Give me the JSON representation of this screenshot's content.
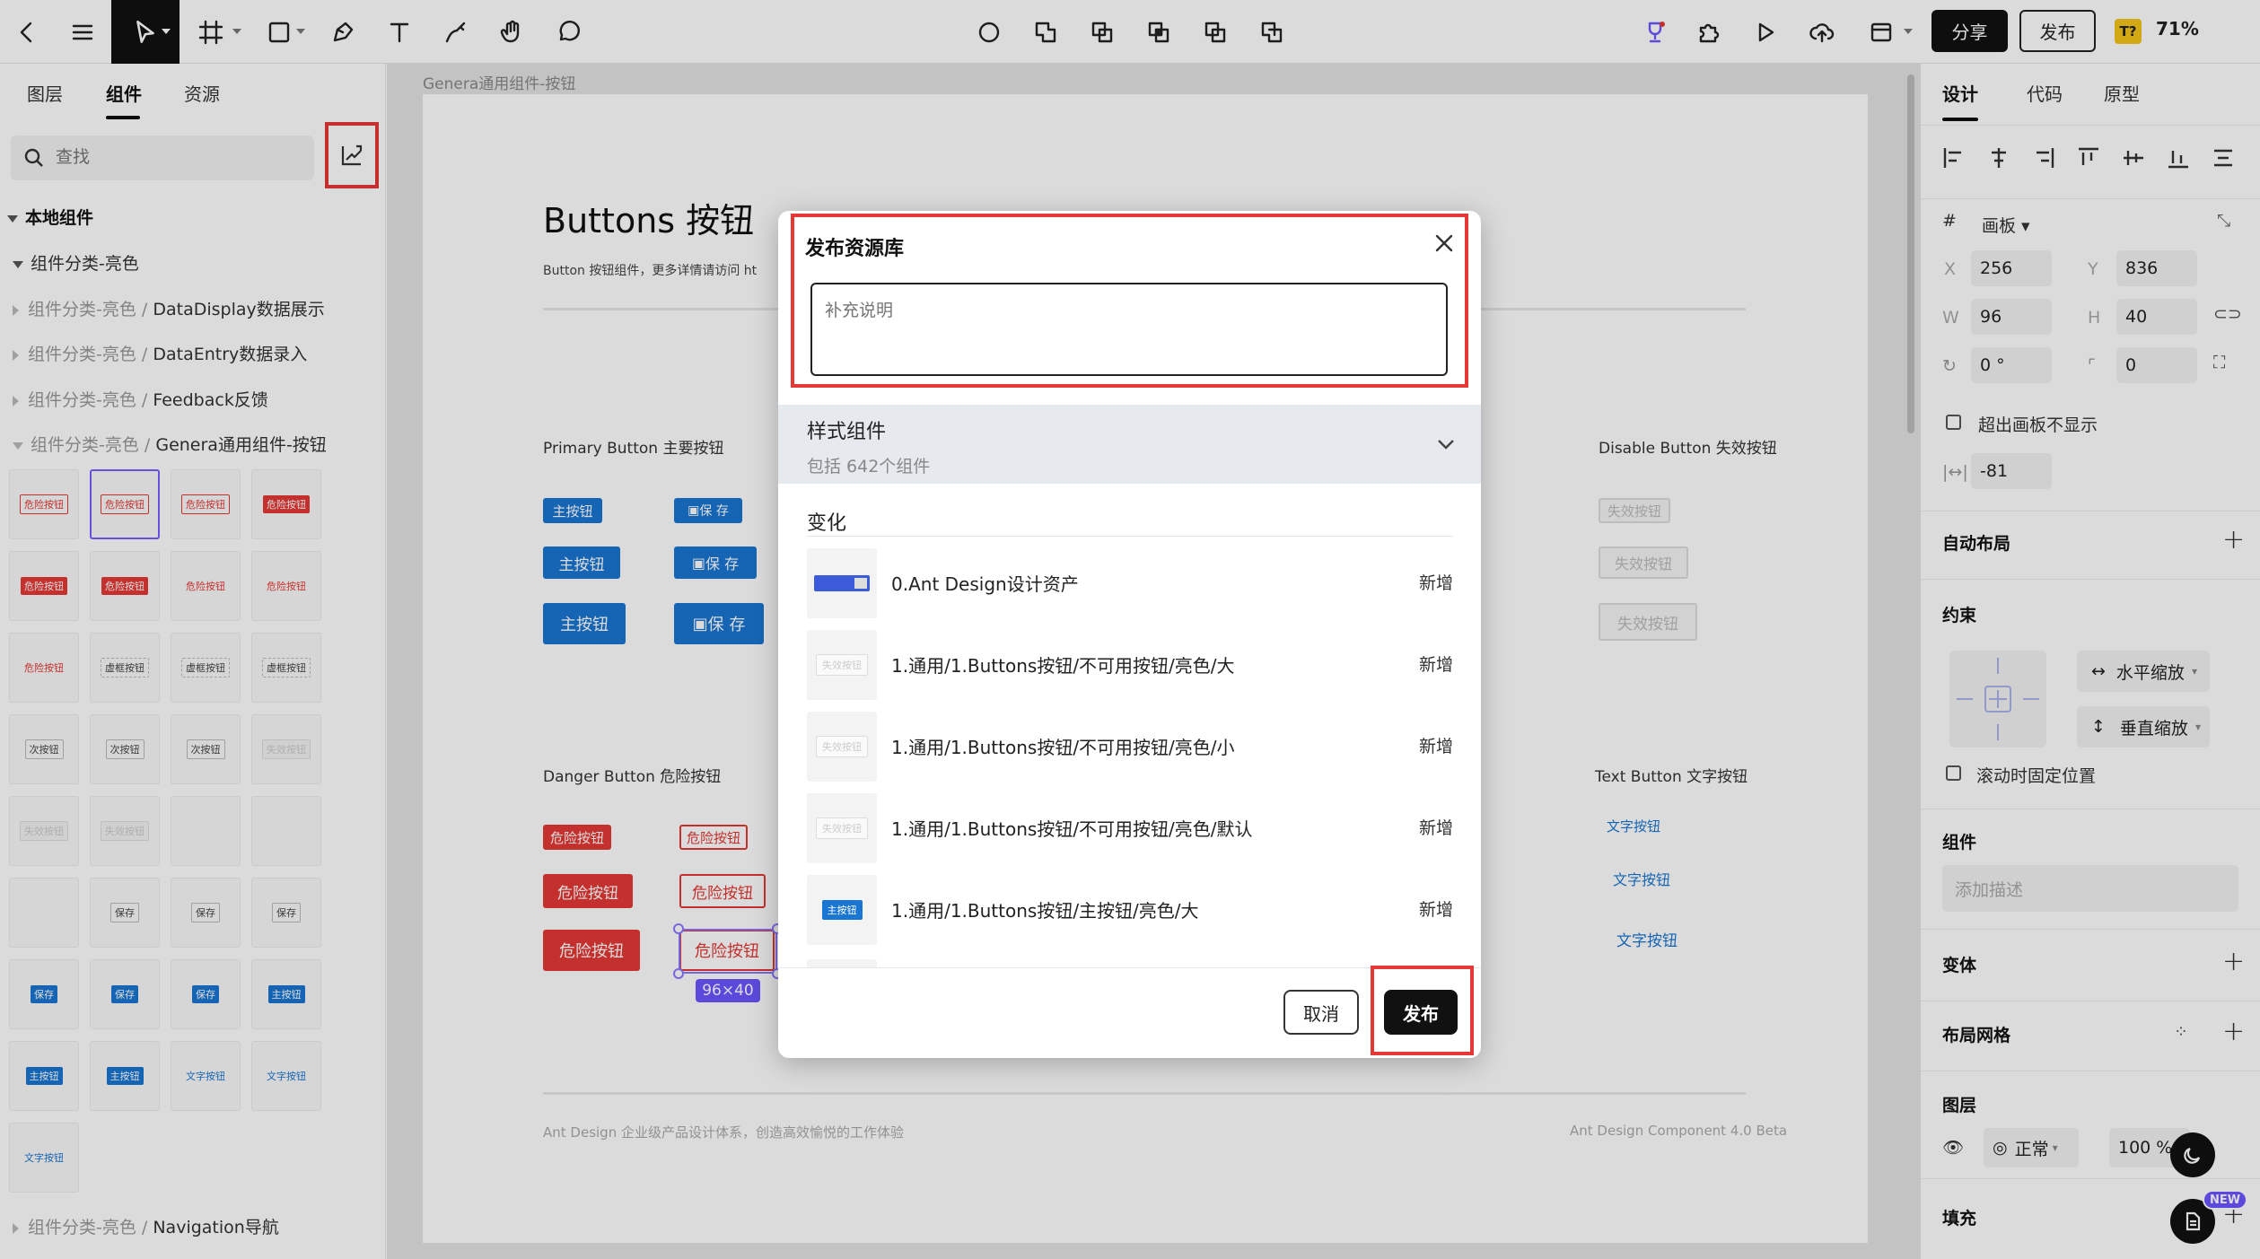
{
  "toolbar": {
    "share_label": "分享",
    "publish_label": "发布",
    "badge_text": "T?",
    "zoom": "71%"
  },
  "left_panel": {
    "tabs": [
      "图层",
      "组件",
      "资源"
    ],
    "active_tab": "组件",
    "search_placeholder": "查找",
    "section_title": "本地组件",
    "tree": [
      {
        "label": "组件分类-亮色",
        "prefix": "",
        "expanded": true
      },
      {
        "label": "DataDisplay数据展示",
        "prefix": "组件分类-亮色 / ",
        "expanded": false
      },
      {
        "label": "DataEntry数据录入",
        "prefix": "组件分类-亮色 / ",
        "expanded": false
      },
      {
        "label": "Feedback反馈",
        "prefix": "组件分类-亮色 / ",
        "expanded": false
      },
      {
        "label": "Genera通用组件-按钮",
        "prefix": "组件分类-亮色 / ",
        "expanded": true
      },
      {
        "label": "Navigation导航",
        "prefix": "组件分类-亮色 / ",
        "expanded": false
      }
    ],
    "thumbnails": [
      [
        "危险按钮",
        "危险按钮",
        "危险按钮",
        "危险按钮"
      ],
      [
        "危险按钮",
        "危险按钮",
        "危险按钮",
        "危险按钮"
      ],
      [
        "危险按钮",
        "虚框按钮",
        "虚框按钮",
        "虚框按钮"
      ],
      [
        "次按钮",
        "次按钮",
        "次按钮",
        "失效按钮"
      ],
      [
        "失效按钮",
        "失效按钮",
        "",
        ""
      ],
      [
        "",
        "保存",
        "保存",
        "保存"
      ],
      [
        "保存",
        "保存",
        "保存",
        "主按钮"
      ],
      [
        "主按钮",
        "主按钮",
        "文字按钮",
        "文字按钮"
      ],
      [
        "文字按钮"
      ]
    ]
  },
  "canvas": {
    "frame_label": "Genera通用组件-按钮",
    "heading": "Buttons 按钮",
    "subheading": "Button 按钮组件，更多详情请访问 ht",
    "primary_title": "Primary Button 主要按钮",
    "danger_title": "Danger Button 危险按钮",
    "disable_title": "Disable Button 失效按钮",
    "text_title": "Text Button 文字按钮",
    "primary_btn": "主按钮",
    "save_btn": "保 存",
    "danger_btn": "危险按钮",
    "disabled_btn": "失效按钮",
    "text_btn": "文字按钮",
    "size_badge": "96×40",
    "footer_left": "Ant Design 企业级产品设计体系，创造高效愉悦的工作体验",
    "footer_right": "Ant Design Component 4.0 Beta"
  },
  "right_panel": {
    "tabs": [
      "设计",
      "代码",
      "原型"
    ],
    "frame_type": "画板",
    "x": "256",
    "y": "836",
    "w": "96",
    "h": "40",
    "rotation": "0 °",
    "radius": "0",
    "clip_label": "超出画板不显示",
    "spacing": "-81",
    "auto_layout": "自动布局",
    "constraints": "约束",
    "h_constraint": "水平缩放",
    "v_constraint": "垂直缩放",
    "fix_scroll": "滚动时固定位置",
    "component": "组件",
    "desc_placeholder": "添加描述",
    "variant": "变体",
    "layout_grid": "布局网格",
    "layer": "图层",
    "blend_mode": "正常",
    "opacity": "100 %",
    "fill": "填充",
    "new_badge": "NEW",
    "labels": {
      "x": "X",
      "y": "Y",
      "w": "W",
      "h": "H"
    }
  },
  "modal": {
    "title": "发布资源库",
    "desc_placeholder": "补充说明",
    "style_group_title": "样式组件",
    "style_group_sub": "包括 642个组件",
    "changes_title": "变化",
    "changes": [
      {
        "name": "0.Ant Design设计资产",
        "status": "新增",
        "thumb": "ant"
      },
      {
        "name": "1.通用/1.Buttons按钮/不可用按钮/亮色/大",
        "status": "新增",
        "thumb": "disabled",
        "thumb_label": "失效按钮"
      },
      {
        "name": "1.通用/1.Buttons按钮/不可用按钮/亮色/小",
        "status": "新增",
        "thumb": "disabled",
        "thumb_label": "失效按钮"
      },
      {
        "name": "1.通用/1.Buttons按钮/不可用按钮/亮色/默认",
        "status": "新增",
        "thumb": "disabled",
        "thumb_label": "失效按钮"
      },
      {
        "name": "1.通用/1.Buttons按钮/主按钮/亮色/大",
        "status": "新增",
        "thumb": "primary",
        "thumb_label": "主按钮"
      }
    ],
    "cancel_label": "取消",
    "publish_label": "发布"
  },
  "colors": {
    "accent_primary": "#1976d2",
    "danger": "#e53935",
    "highlight": "#e53935",
    "selection": "#8a78ff"
  }
}
